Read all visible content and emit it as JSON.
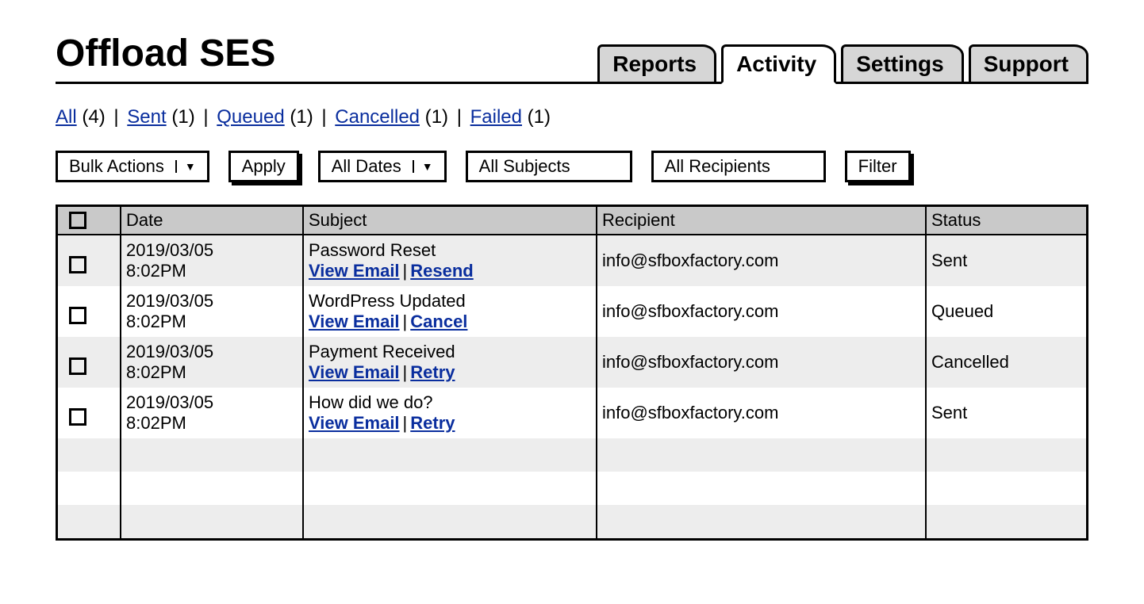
{
  "title": "Offload SES",
  "tabs": [
    {
      "label": "Reports",
      "active": false
    },
    {
      "label": "Activity",
      "active": true
    },
    {
      "label": "Settings",
      "active": false
    },
    {
      "label": "Support",
      "active": false
    }
  ],
  "status_filters": [
    {
      "label": "All",
      "count": 4
    },
    {
      "label": "Sent",
      "count": 1
    },
    {
      "label": "Queued",
      "count": 1
    },
    {
      "label": "Cancelled",
      "count": 1
    },
    {
      "label": "Failed",
      "count": 1
    }
  ],
  "controls": {
    "bulk_actions": "Bulk Actions",
    "apply": "Apply",
    "all_dates": "All Dates",
    "all_subjects": "All Subjects",
    "all_recipients": "All Recipients",
    "filter": "Filter"
  },
  "columns": {
    "checkbox": "",
    "date": "Date",
    "subject": "Subject",
    "recipient": "Recipient",
    "status": "Status"
  },
  "actions_labels": {
    "view": "View Email",
    "resend": "Resend",
    "cancel": "Cancel",
    "retry": "Retry"
  },
  "rows": [
    {
      "date_line1": "2019/03/05",
      "date_line2": "8:02PM",
      "subject": "Password Reset",
      "action2": "Resend",
      "recipient": "info@sfboxfactory.com",
      "status": "Sent"
    },
    {
      "date_line1": "2019/03/05",
      "date_line2": "8:02PM",
      "subject": "WordPress Updated",
      "action2": "Cancel",
      "recipient": "info@sfboxfactory.com",
      "status": "Queued"
    },
    {
      "date_line1": "2019/03/05",
      "date_line2": "8:02PM",
      "subject": "Payment Received",
      "action2": "Retry",
      "recipient": "info@sfboxfactory.com",
      "status": "Cancelled"
    },
    {
      "date_line1": "2019/03/05",
      "date_line2": "8:02PM",
      "subject": "How did we do?",
      "action2": "Retry",
      "recipient": "info@sfboxfactory.com",
      "status": "Sent"
    }
  ]
}
